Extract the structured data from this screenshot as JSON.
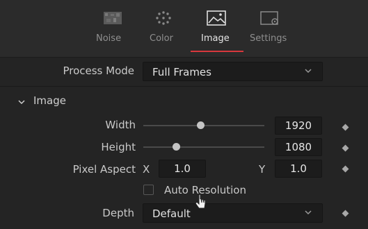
{
  "tabs": [
    {
      "label": "Noise",
      "icon": "noise-icon",
      "active": false
    },
    {
      "label": "Color",
      "icon": "color-dots-icon",
      "active": false
    },
    {
      "label": "Image",
      "icon": "image-icon",
      "active": true
    },
    {
      "label": "Settings",
      "icon": "settings-icon",
      "active": false
    }
  ],
  "process_mode": {
    "label": "Process Mode",
    "value": "Full Frames"
  },
  "section": {
    "title": "Image",
    "expanded": true
  },
  "width": {
    "label": "Width",
    "value": "1920"
  },
  "height": {
    "label": "Height",
    "value": "1080"
  },
  "pixel_aspect": {
    "label": "Pixel Aspect",
    "x_label": "X",
    "x_value": "1.0",
    "y_label": "Y",
    "y_value": "1.0"
  },
  "auto_resolution": {
    "label": "Auto Resolution",
    "checked": false
  },
  "depth": {
    "label": "Depth",
    "value": "Default"
  },
  "colors": {
    "accent": "#d8383c",
    "background": "#242424",
    "field": "#1c1c1c"
  }
}
